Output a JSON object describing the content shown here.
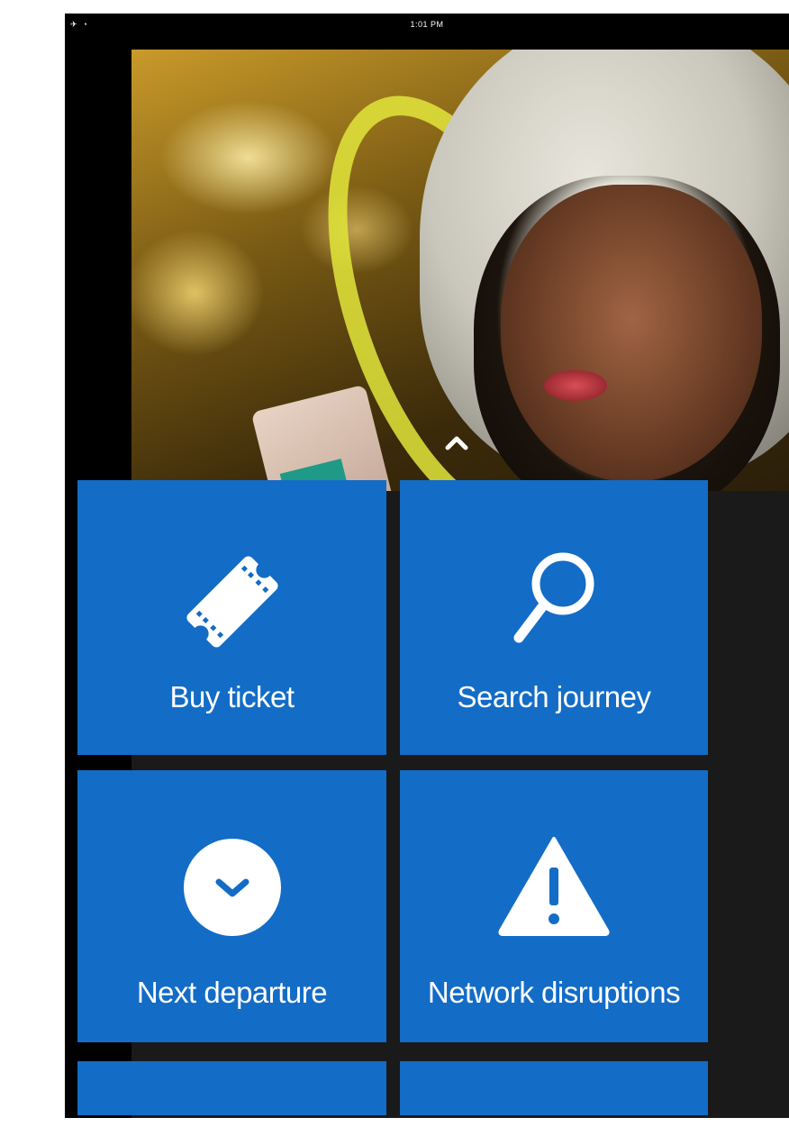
{
  "status_bar": {
    "time": "1:01 PM",
    "left_icons": [
      "airplane-icon",
      "wifi-icon"
    ]
  },
  "hero": {
    "swipe_hint_icon": "chevron-up-icon"
  },
  "tiles": [
    {
      "label": "Buy ticket",
      "icon": "ticket-icon"
    },
    {
      "label": "Search journey",
      "icon": "magnifier-icon"
    },
    {
      "label": "Next departure",
      "icon": "clock-icon"
    },
    {
      "label": "Network disruptions",
      "icon": "warning-icon"
    }
  ],
  "colors": {
    "tile_blue": "#136cc6",
    "device_black": "#000000",
    "icon_white": "#ffffff"
  }
}
